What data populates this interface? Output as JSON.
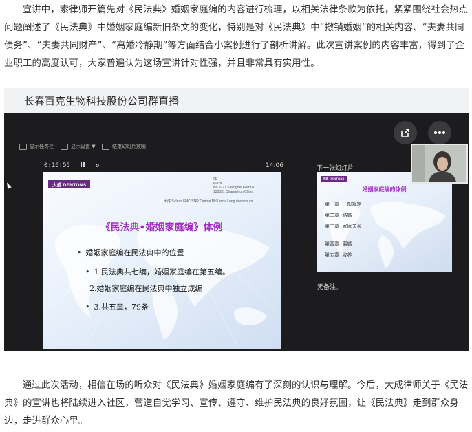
{
  "article": {
    "paragraph_1": "宣讲中，索律师开篇先对《民法典》婚姻家庭编的内容进行梳理，以相关法律条款为依托，紧紧围绕社会热点问题阐述了《民法典》中婚姻家庭编新旧条文的变化，特别是对《民法典》中“撤销婚姻”的相关内容、“夫妻共同债务”、“夫妻共同财产”、“离婚冷静期”等方面结合小案例进行了剖析讲解。此次宣讲案例的内容丰富，得到了企业职工的高度认可，大家普遍认为这场宣讲针对性强，并且非常具有实用性。",
    "paragraph_2": "通过此次活动，相信在场的听众对《民法典》婚姻家庭编有了深刻的认识与理解。今后，大成律师关于《民法典》的宣讲也将陆续进入社区，营造自觉学习、宣传、遵守、维护民法典的良好氛围，让《民法典》走到群众身边，走进群众心里。"
  },
  "live": {
    "header_title": "长春百克生物科技股份公司群直播",
    "share_icon": "share-icon",
    "more_icon": "more-icon"
  },
  "presenter": {
    "toolbar": [
      "显示任务栏",
      "显示设置 ▼",
      "结束幻灯片放映"
    ],
    "timer": "0:16:55",
    "clock": "14:06",
    "next_slide_label": "下一张幻灯片",
    "notes": "无备注。"
  },
  "slide": {
    "logo": "大成 DENTONS",
    "address_lines": [
      "9F",
      "Plaza",
      "No.3777 Shengbei Avenue",
      "130031 Changchun,China"
    ],
    "firm_line": "大成 Salans FMC SNR Denton McKenna Long  dentons.cn",
    "title": "《民法典•婚姻家庭编》体例",
    "bullets": [
      "婚姻家庭编在民法典中的位置",
      "1.民法典共七编，婚姻家庭编在第五编。",
      "2.婚姻家庭编在民法典中独立成编",
      "3.共五章，79条"
    ]
  },
  "next_slide": {
    "logo": "大成 DENTONS",
    "title": "婚姻家庭编的体例",
    "items": [
      {
        "chapter": "第一章",
        "name": "一般规定"
      },
      {
        "chapter": "第二章",
        "name": "结婚"
      },
      {
        "chapter": "第三章",
        "name": "家庭关系"
      },
      {
        "chapter": "第四章",
        "name": "离婚"
      },
      {
        "chapter": "第五章",
        "name": "收养"
      }
    ]
  },
  "colors": {
    "slide_title": "#a42bc4",
    "logo_bg": "#6a2b82",
    "stream_bg": "#1c1c1e"
  }
}
